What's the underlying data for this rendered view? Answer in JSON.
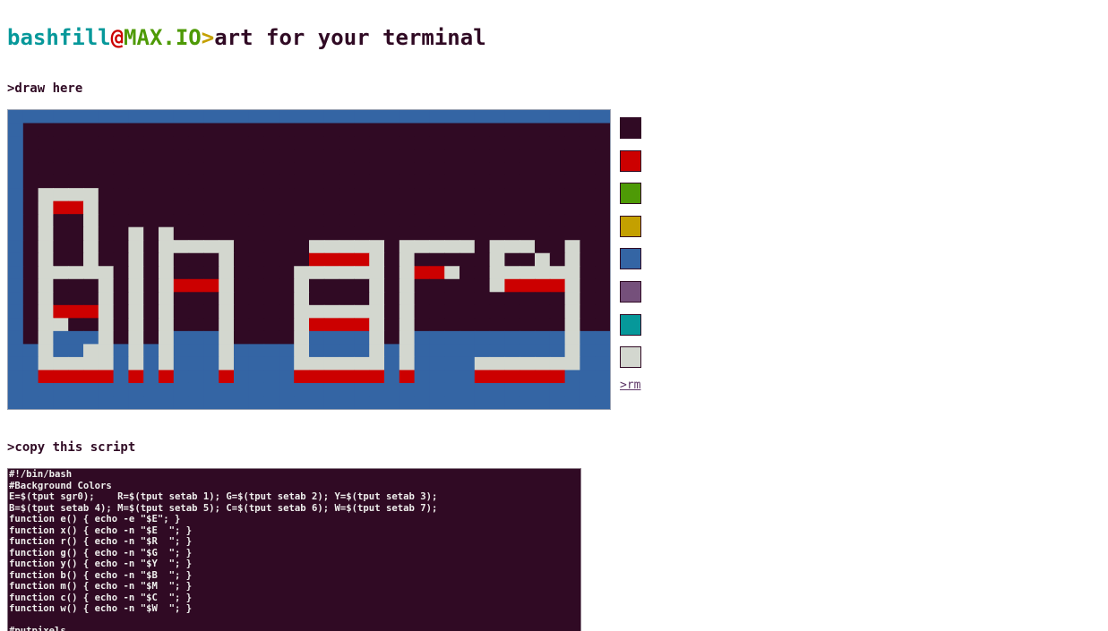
{
  "title": {
    "user": "bashfill",
    "at": "@",
    "host": "MAX.IO",
    "prompt": ">",
    "rest": "art for your terminal"
  },
  "draw_heading": ">draw here",
  "copy_heading": ">copy this script",
  "rm_label": ">rm",
  "colors": {
    "E": "#300a24",
    "R": "#cc0000",
    "G": "#4e9a06",
    "Y": "#c4a000",
    "B": "#3465a4",
    "M": "#75507b",
    "C": "#06989a",
    "W": "#d3d7cf"
  },
  "palette": [
    {
      "name": "black",
      "code": "E"
    },
    {
      "name": "red",
      "code": "R"
    },
    {
      "name": "green",
      "code": "G"
    },
    {
      "name": "yellow",
      "code": "Y"
    },
    {
      "name": "blue",
      "code": "B"
    },
    {
      "name": "magenta",
      "code": "M"
    },
    {
      "name": "cyan",
      "code": "C"
    },
    {
      "name": "white",
      "code": "W"
    }
  ],
  "pixel_grid": [
    "BBBBBBBBBBBBBBBBBBBBBBBBBBBBBBBBBBBBBBBB",
    "BEEEEEEEEEEEEEEEEEEEEEEEEEEEEEEEEEEEEEEE",
    "BEEEEEEEEEEEEEEEEEEEEEEEEEEEEEEEEEEEEEEE",
    "BEEEEEEEEEEEEEEEEEEEEEEEEEEEEEEEEEEEEEEE",
    "BEEEEEEEEEEEEEEEEEEEEEEEEEEEEEEEEEEEEEEE",
    "BEEEEEEEEEEEEEEEEEEEEEEEEEEEEEEEEEEEEEEE",
    "BEWWWWEEEEEEEEEEEEEEEEEEEEEEEEEEEEEEEEEE",
    "BEWRRWEEEEEEEEEEEEEEEEEEEEEEEEEEEEEEEEEE",
    "BEWEEWEEEEEEEEEEEEEEEEEEEEEEEEEEEEEEEEEE",
    "BEWEEWEEWEWEEEEEEEEEEEEEEEEEEEEEEEEEEEEE",
    "BEWEEWEEWEWWWWWEEEEEWWWWWEWWWWWEWWWEEWEE",
    "BEWEEWEEWEWEEEWEEEEERRRRWEWEEEEEWEEWEWEE",
    "BEWWWWWEWEWEEEWEEEEWWWWWWEWRRWEEWWWWWWEE",
    "BEWEEEWEWEWRRRWEEEEWEEEEWEWEEEEEWRRRRWEE",
    "BEWEEEWEWEWEEEWEEEEWEEEEWEWEEEEEEEEEEWEE",
    "BEWRRRWEWEWEEEWEEEEWWWWWWEWEEEEEEEEEEWEE",
    "BEWWEEWEWEWEEEWEEEEWRRRRWEWEEEEEEEEEEWEE",
    "BEWBBBWEWEWBBBWEEEEWBBBBWEWBBBBBBBBBBWBB",
    "BBWBBWWBWBWBBBWBBBBWBBBBWBWBBBBBBBBBBWBB",
    "BBWWWWWBWBWBBBWBBBBWWWWWWBWBBBBWWWWWWWBB",
    "BBRRRRRBRBRBBBRBBBBRRRRRRBRBBBBRRRRRRBBB",
    "BBBBBBBBBBBBBBBBBBBBBBBBBBBBBBBBBBBBBBBB",
    "BBBBBBBBBBBBBBBBBBBBBBBBBBBBBBBBBBBBBBBB"
  ],
  "script_lines": [
    "#!/bin/bash",
    "#Background Colors",
    "E=$(tput sgr0);    R=$(tput setab 1); G=$(tput setab 2); Y=$(tput setab 3);",
    "B=$(tput setab 4); M=$(tput setab 5); C=$(tput setab 6); W=$(tput setab 7);",
    "function e() { echo -e \"$E\"; }",
    "function x() { echo -n \"$E  \"; }",
    "function r() { echo -n \"$R  \"; }",
    "function g() { echo -n \"$G  \"; }",
    "function y() { echo -n \"$Y  \"; }",
    "function b() { echo -n \"$B  \"; }",
    "function m() { echo -n \"$M  \"; }",
    "function c() { echo -n \"$C  \"; }",
    "function w() { echo -n \"$W  \"; }",
    "",
    "#putpixels"
  ]
}
